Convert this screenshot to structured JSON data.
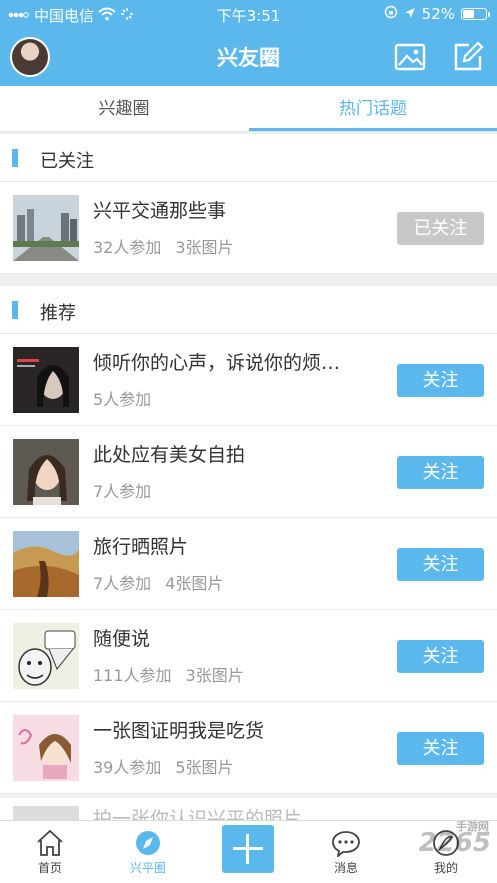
{
  "status": {
    "carrier": "中国电信",
    "time": "下午3:51",
    "battery": "52%",
    "battery_level": 0.52
  },
  "navbar": {
    "title": "兴友圈",
    "icons": [
      "avatar",
      "photo-icon",
      "edit-icon"
    ]
  },
  "tabs": [
    {
      "label": "兴趣圈",
      "active": false
    },
    {
      "label": "热门话题",
      "active": true
    }
  ],
  "followed_section": {
    "label": "已关注",
    "items": [
      {
        "name": "兴平交通那些事",
        "participants": "32人参加",
        "images": "3张图片",
        "button": "已关注"
      }
    ]
  },
  "recommended_section": {
    "label": "推荐",
    "items": [
      {
        "name": "倾听你的心声，诉说你的烦…",
        "participants": "5人参加",
        "images": "",
        "button": "关注"
      },
      {
        "name": "此处应有美女自拍",
        "participants": "7人参加",
        "images": "",
        "button": "关注"
      },
      {
        "name": "旅行晒照片",
        "participants": "7人参加",
        "images": "4张图片",
        "button": "关注"
      },
      {
        "name": "随便说",
        "participants": "111人参加",
        "images": "3张图片",
        "button": "关注"
      },
      {
        "name": "一张图证明我是吃货",
        "participants": "39人参加",
        "images": "5张图片",
        "button": "关注"
      }
    ],
    "partial_item": "拍一张你认识兴平的照片"
  },
  "tabbar": [
    {
      "label": "首页",
      "icon": "home-icon",
      "active": false
    },
    {
      "label": "兴平圈",
      "icon": "compass-icon",
      "active": true
    },
    {
      "label": "",
      "icon": "plus-icon",
      "active": false
    },
    {
      "label": "消息",
      "icon": "chat-icon",
      "active": false
    },
    {
      "label": "我的",
      "icon": "profile-icon",
      "active": false
    }
  ],
  "watermark": {
    "text": "2265",
    "sub": "手游网"
  },
  "colors": {
    "accent": "#5bb8ec",
    "followed_button": "#c8c8c8"
  }
}
